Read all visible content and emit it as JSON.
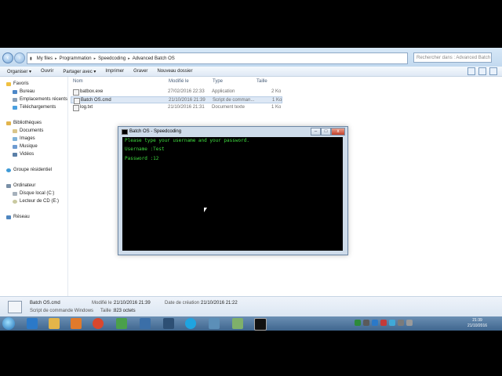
{
  "address_bar": {
    "crumbs": [
      "My files",
      "Programmation",
      "Speedcoding",
      "Advanced Batch OS"
    ],
    "search_placeholder": "Rechercher dans : Advanced Batch OS"
  },
  "toolbar": {
    "organize": "Organiser ▾",
    "open": "Ouvrir",
    "share": "Partager avec ▾",
    "print": "Imprimer",
    "burn": "Graver",
    "new_folder": "Nouveau dossier"
  },
  "sidebar": {
    "favorites": "Favoris",
    "desktop": "Bureau",
    "recent": "Emplacements récents",
    "downloads": "Téléchargements",
    "libraries": "Bibliothèques",
    "documents": "Documents",
    "images": "Images",
    "music": "Musique",
    "videos": "Vidéos",
    "homegroup": "Groupe résidentiel",
    "computer": "Ordinateur",
    "local_disk": "Disque local (C:)",
    "cd_drive": "Lecteur de CD (E:)",
    "network": "Réseau"
  },
  "columns": {
    "name": "Nom",
    "modified": "Modifié le",
    "type": "Type",
    "size": "Taille"
  },
  "files": [
    {
      "name": "batbox.exe",
      "modified": "27/02/2016 22:33",
      "type": "Application",
      "size": "2 Ko"
    },
    {
      "name": "Batch OS.cmd",
      "modified": "21/10/2016 21:39",
      "type": "Script de comman...",
      "size": "1 Ko"
    },
    {
      "name": "log.txt",
      "modified": "21/10/2016 21:31",
      "type": "Document texte",
      "size": "1 Ko"
    }
  ],
  "statusbar": {
    "filename": "Batch OS.cmd",
    "filetype": "Script de commande Windows",
    "modified_label": "Modifié le :",
    "modified_value": "21/10/2016 21:39",
    "created_label": "Date de création :",
    "created_value": "21/10/2016 21:22",
    "size_label": "Taille :",
    "size_value": "823 octets"
  },
  "console": {
    "title": "Batch OS - Speedcoding",
    "lines": [
      "Please type your username and your password.",
      "Username :Test",
      "Password :12"
    ],
    "min": "–",
    "max": "□",
    "close": "x"
  },
  "taskbar": {
    "time": "21:39",
    "date": "21/10/2016"
  },
  "colors": {
    "console_text": "#3fdc3f",
    "taskbar": "#4f76a0",
    "selection": "#dde8f5"
  }
}
